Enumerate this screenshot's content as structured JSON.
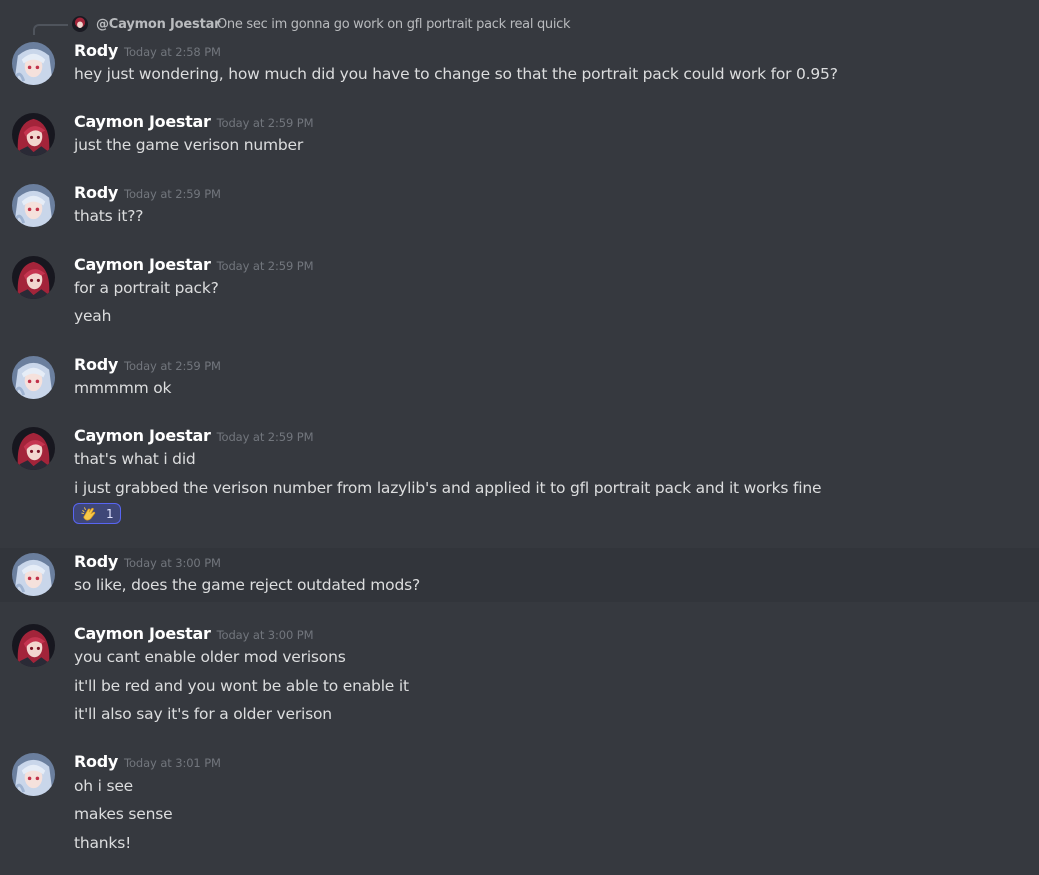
{
  "reply": {
    "author": "@Caymon Joestar",
    "text": "One sec im gonna go work on gfl portrait pack real quick"
  },
  "avatars": {
    "rody": "silver-haired-anime-avatar",
    "caymon": "red-haired-anime-avatar"
  },
  "messages": [
    {
      "author": "Rody",
      "time": "Today at 2:58 PM",
      "lines": [
        "hey just wondering, how much did you have to change so that the portrait pack could work for 0.95?"
      ]
    },
    {
      "author": "Caymon Joestar",
      "time": "Today at 2:59 PM",
      "lines": [
        "just the game verison number"
      ]
    },
    {
      "author": "Rody",
      "time": "Today at 2:59 PM",
      "lines": [
        "thats it??"
      ]
    },
    {
      "author": "Caymon Joestar",
      "time": "Today at 2:59 PM",
      "lines": [
        "for a portrait pack?",
        "yeah"
      ]
    },
    {
      "author": "Rody",
      "time": "Today at 2:59 PM",
      "lines": [
        "mmmmm ok"
      ]
    },
    {
      "author": "Caymon Joestar",
      "time": "Today at 2:59 PM",
      "lines": [
        "that's what i did",
        "i just grabbed the verison number from lazylib's and applied it to gfl portrait pack and it works fine"
      ],
      "reaction": {
        "emoji": "clapping-hands-emoji",
        "count": "1"
      }
    },
    {
      "author": "Rody",
      "time": "Today at 3:00 PM",
      "lines": [
        "so like, does the game reject outdated mods?"
      ]
    },
    {
      "author": "Caymon Joestar",
      "time": "Today at 3:00 PM",
      "lines": [
        "you cant enable older mod verisons",
        "it'll be red and you wont be able to enable it",
        "it'll also say it's for a older verison"
      ]
    },
    {
      "author": "Rody",
      "time": "Today at 3:01 PM",
      "lines": [
        "oh i see",
        "makes sense",
        "thanks!"
      ]
    }
  ]
}
